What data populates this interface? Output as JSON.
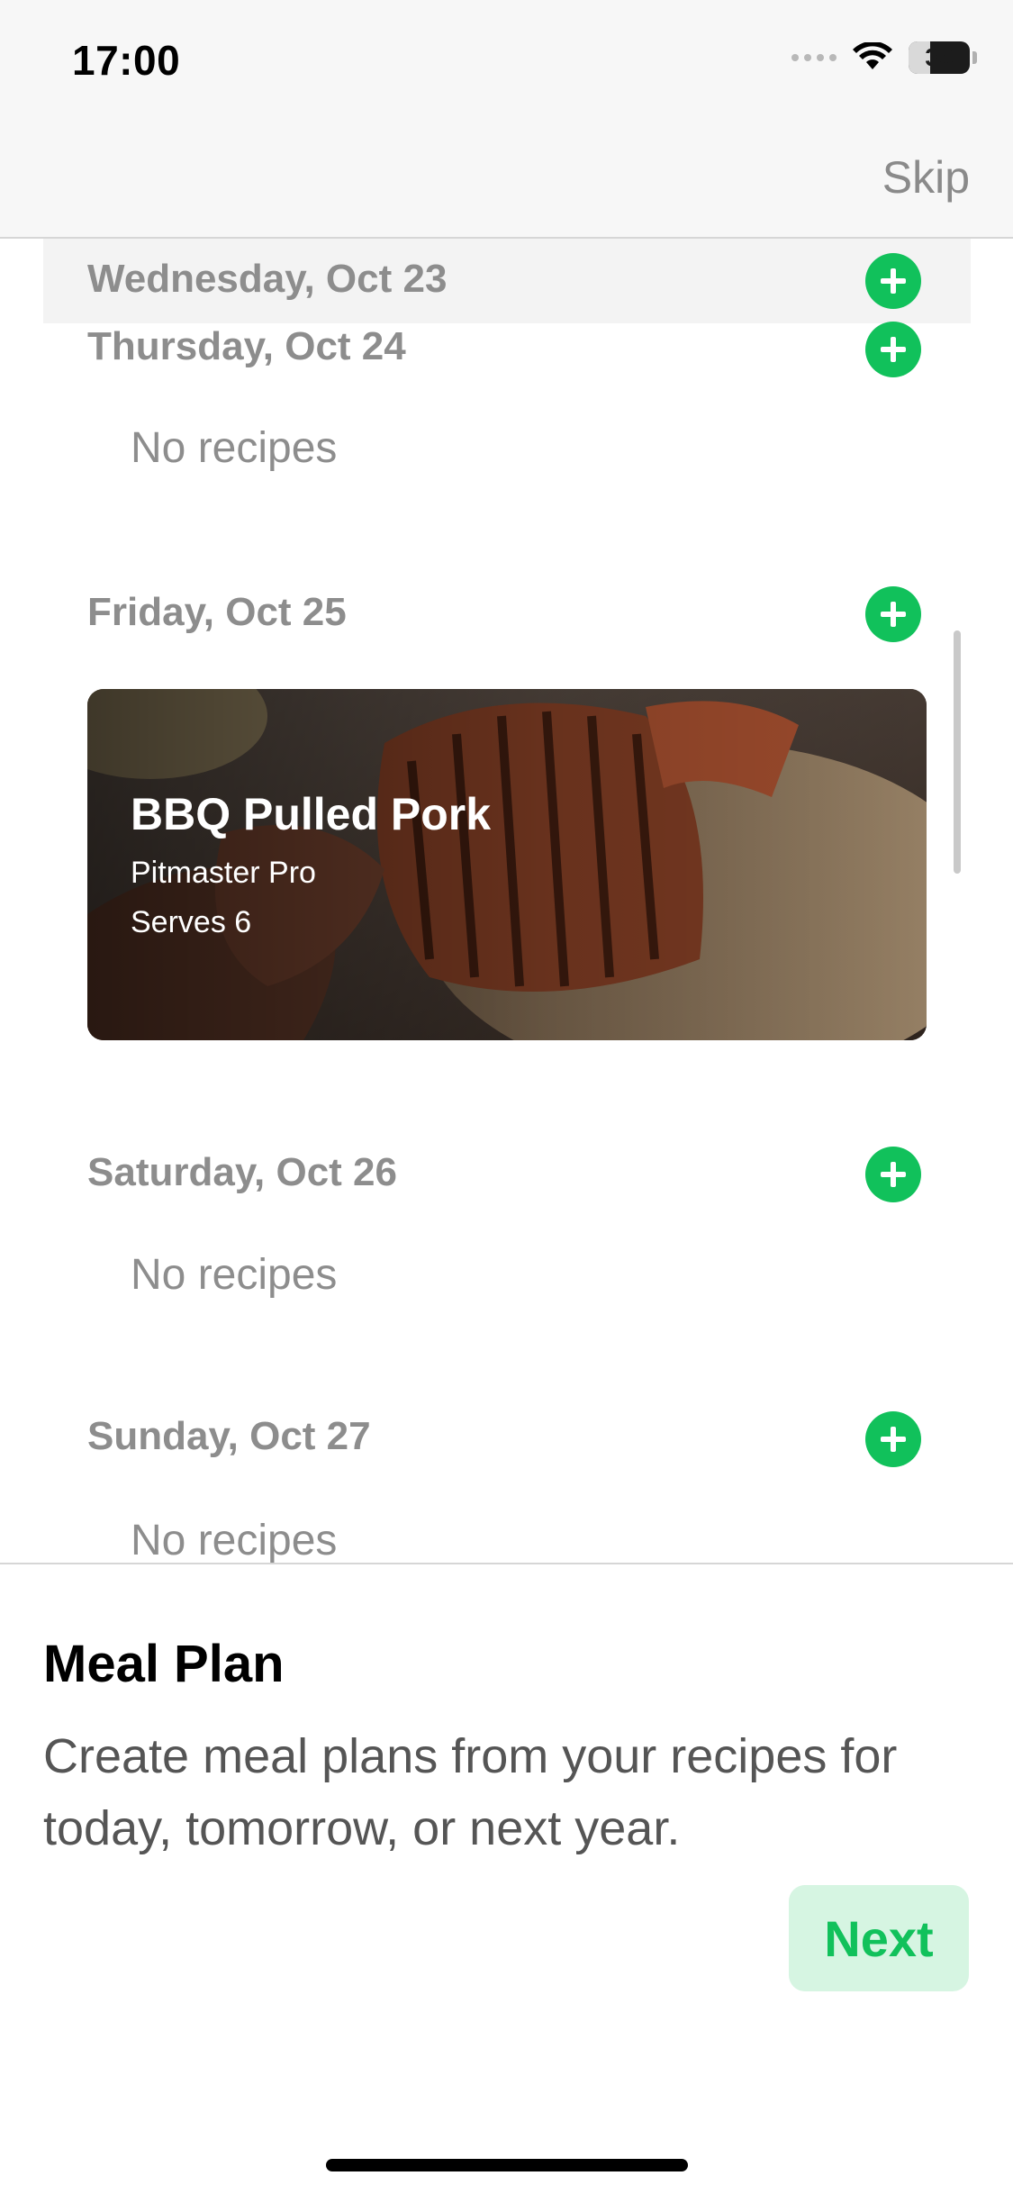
{
  "status_bar": {
    "time": "17:00",
    "battery_level": "35",
    "icons": [
      "cellular-signal-icon",
      "wifi-icon",
      "battery-icon"
    ]
  },
  "nav": {
    "skip_label": "Skip"
  },
  "meal_plan": {
    "days": [
      {
        "label": "Wednesday, Oct 23"
      },
      {
        "label": "Thursday, Oct 24",
        "empty_text": "No recipes"
      },
      {
        "label": "Friday, Oct 25"
      },
      {
        "label": "Saturday, Oct 26",
        "empty_text": "No recipes"
      },
      {
        "label": "Sunday, Oct 27",
        "empty_text": "No recipes"
      }
    ],
    "recipe": {
      "title": "BBQ Pulled Pork",
      "author": "Pitmaster Pro",
      "serves": "Serves 6",
      "image": "bbq-pulled-pork-photo"
    }
  },
  "sheet": {
    "title": "Meal Plan",
    "description": "Create meal plans from your recipes for today, tomorrow, or next year.",
    "next_label": "Next"
  },
  "colors": {
    "accent": "#11c15b",
    "accent_light": "#d6f5e2",
    "secondary_text": "#8d8d8d"
  }
}
